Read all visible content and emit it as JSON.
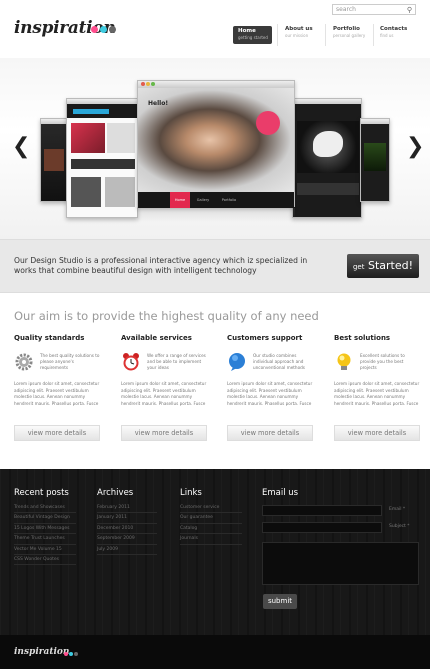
{
  "header": {
    "logo": "inspiration",
    "logo_dots": [
      "#ff4d8d",
      "#3ecbe0",
      "#666666"
    ],
    "search_placeholder": "search",
    "nav": [
      {
        "title": "Home",
        "sub": "getting started"
      },
      {
        "title": "About us",
        "sub": "our mission"
      },
      {
        "title": "Portfolio",
        "sub": "personal gallery"
      },
      {
        "title": "Contacts",
        "sub": "find us"
      }
    ]
  },
  "slider": {
    "hello_text": "Hello!",
    "center_tabs": [
      "Home",
      "Gallery",
      "Portfolio"
    ]
  },
  "intro": {
    "text": "Our Design Studio is a professional interactive agency which iz specialized in works that combine beautiful design with intelligent technology",
    "cta_small": "get",
    "cta_big": "Started!"
  },
  "services": {
    "heading": "Our aim is to provide the highest quality of any need",
    "items": [
      {
        "title": "Quality standards",
        "icon": "gear-icon",
        "short": "The best quality solutions to please anyone's requirements",
        "long": "Lorem ipsum dolor sit amet, consectetur adipiscing elit. Praesent vestibulum molestie lacus. Aenean nonummy hendrerit mauris. Phasellus porta. Fusce",
        "button": "view more details"
      },
      {
        "title": "Available services",
        "icon": "alarm-clock-icon",
        "short": "We offer a range of services and be able to implement your ideas",
        "long": "Lorem ipsum dolor sit amet, consectetur adipiscing elit. Praesent vestibulum molestie lacus. Aenean nonummy hendrerit mauris. Phasellus porta. Fusce",
        "button": "view more details"
      },
      {
        "title": "Customers support",
        "icon": "chat-bubble-icon",
        "short": "Our studio combines individual approach and unconventional methods",
        "long": "Lorem ipsum dolor sit amet, consectetur adipiscing elit. Praesent vestibulum molestie lacus. Aenean nonummy hendrerit mauris. Phasellus porta. Fusce",
        "button": "view more details"
      },
      {
        "title": "Best solutions",
        "icon": "lightbulb-icon",
        "short": "Excellent solutions to provide you the best projects",
        "long": "Lorem ipsum dolor sit amet, consectetur adipiscing elit. Praesent vestibulum molestie lacus. Aenean nonummy hendrerit mauris. Phasellus porta. Fusce",
        "button": "view more details"
      }
    ]
  },
  "footer": {
    "recent_posts": {
      "title": "Recent posts",
      "items": [
        "Trends and Showcases",
        "Beautiful Vintage Design",
        "15 Logos With Messages",
        "Theme Trust Launches",
        "Vector Me Volume 15",
        "CSS Wonder Quotes"
      ]
    },
    "archives": {
      "title": "Archives",
      "items": [
        "February 2011",
        "January 2011",
        "December 2010",
        "September 2009",
        "July 2009"
      ]
    },
    "links": {
      "title": "Links",
      "items": [
        "Customer service",
        "Our guarantee",
        "Catalog",
        "Journals"
      ]
    },
    "email": {
      "title": "Email us",
      "email_label": "Email *",
      "subject_label": "Subject *",
      "submit": "submit"
    }
  },
  "bottom": {
    "logo": "inspiration"
  }
}
